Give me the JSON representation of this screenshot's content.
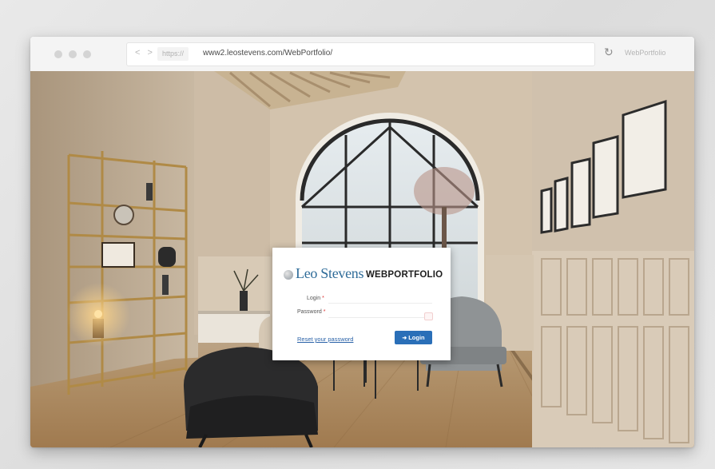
{
  "browser": {
    "nav_arrows": "< >",
    "protocol": "https://",
    "url": "www2.leostevens.com/WebPortfolio/",
    "reload_icon": "reload-icon",
    "app_name": "WebPortfolio"
  },
  "login": {
    "brand_name": "Leo Stevens",
    "brand_product": "WEBPORTFOLIO",
    "login_label": "Login",
    "password_label": "Password",
    "required_mark": "*",
    "reset_link": "Reset your password",
    "submit_label": "Login",
    "submit_icon": "login-icon"
  },
  "colors": {
    "accent": "#2a6fb8",
    "brand_blue": "#2f6c99",
    "required": "#dd3333"
  }
}
